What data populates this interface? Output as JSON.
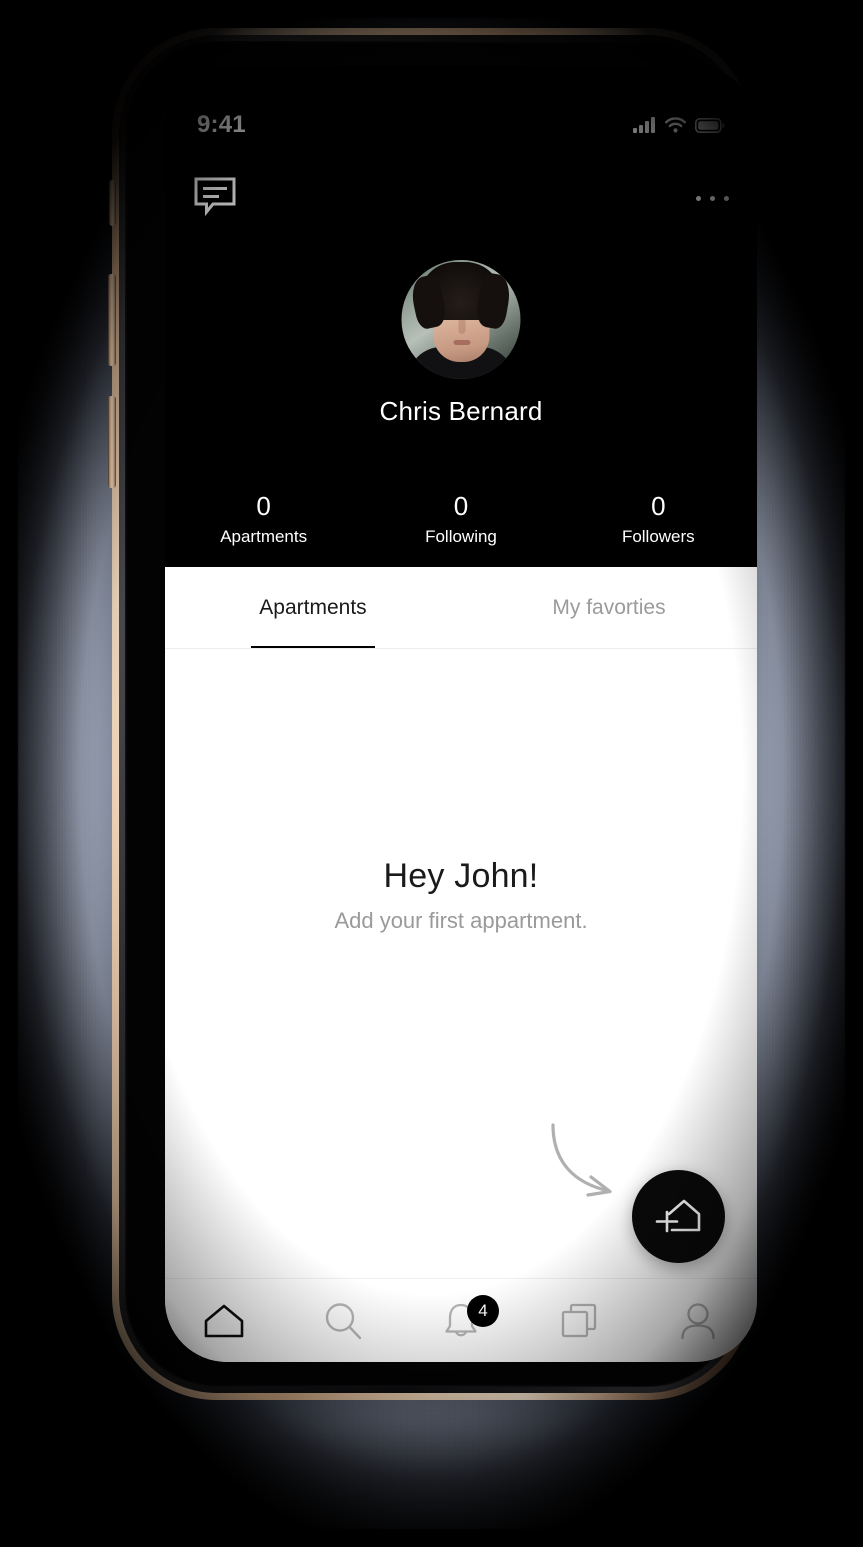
{
  "status_bar": {
    "time": "9:41",
    "signal_icon": "cellular-signal-icon",
    "wifi_icon": "wifi-icon",
    "battery_icon": "battery-full-icon"
  },
  "nav": {
    "messages_icon": "chat-bubble-icon",
    "more_icon": "more-options-icon"
  },
  "profile": {
    "avatar_alt": "user-avatar",
    "name": "Chris Bernard",
    "stats": [
      {
        "value": "0",
        "label": "Apartments"
      },
      {
        "value": "0",
        "label": "Following"
      },
      {
        "value": "0",
        "label": "Followers"
      }
    ]
  },
  "tabs": [
    {
      "label": "Apartments",
      "active": true
    },
    {
      "label": "My favorties",
      "active": false
    }
  ],
  "empty_state": {
    "title": "Hey John!",
    "subtitle": "Add your first appartment.",
    "hint_arrow": "curved-arrow-hint"
  },
  "fab": {
    "icon": "add-home-icon",
    "label": "Add apartment"
  },
  "bottom_nav": [
    {
      "icon": "home-icon",
      "name": "home",
      "active": true,
      "badge": ""
    },
    {
      "icon": "search-icon",
      "name": "search",
      "active": false,
      "badge": ""
    },
    {
      "icon": "bell-icon",
      "name": "notifications",
      "active": false,
      "badge": "4"
    },
    {
      "icon": "layers-icon",
      "name": "collections",
      "active": false,
      "badge": ""
    },
    {
      "icon": "person-icon",
      "name": "profile",
      "active": false,
      "badge": ""
    }
  ],
  "colors": {
    "screen_header_bg": "#000000",
    "content_bg": "#ffffff",
    "accent": "#000000",
    "inactive_text": "#9b9b9b",
    "subtitle_text": "#9a9a9a",
    "backdrop": "#b9c3d9",
    "frame_gold": "#e7c4a1"
  }
}
